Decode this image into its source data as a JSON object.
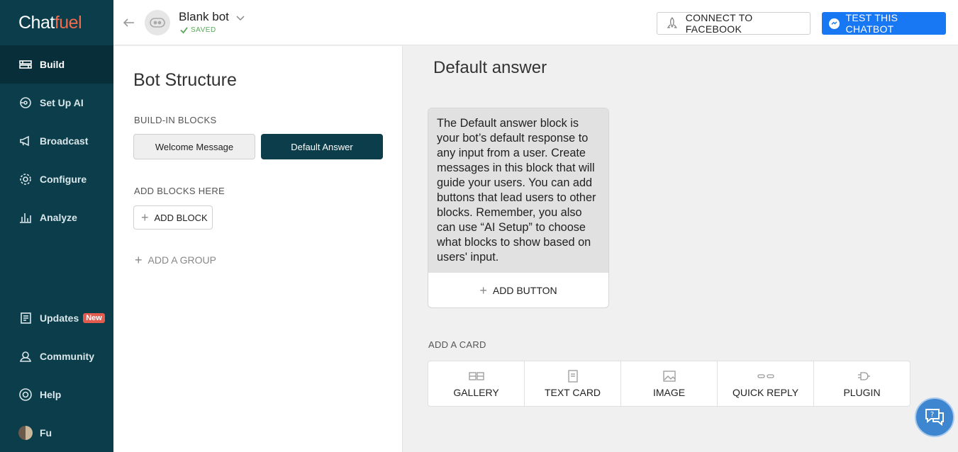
{
  "brand": {
    "logo_part1": "Chat",
    "logo_part2": "fuel"
  },
  "sidebar": {
    "items": [
      {
        "label": "Build",
        "icon": "build-icon"
      },
      {
        "label": "Set Up AI",
        "icon": "ai-icon"
      },
      {
        "label": "Broadcast",
        "icon": "megaphone-icon"
      },
      {
        "label": "Configure",
        "icon": "gear-icon"
      },
      {
        "label": "Analyze",
        "icon": "bar-chart-icon"
      },
      {
        "label": "Updates",
        "icon": "news-icon",
        "badge": "New"
      },
      {
        "label": "Community",
        "icon": "community-icon"
      },
      {
        "label": "Help",
        "icon": "lifebuoy-icon"
      },
      {
        "label": "Fu",
        "icon": "user-avatar"
      }
    ]
  },
  "header": {
    "bot_name": "Blank bot",
    "status": "SAVED",
    "connect_label": "CONNECT TO FACEBOOK",
    "test_label": "TEST THIS CHATBOT"
  },
  "left_panel": {
    "title": "Bot Structure",
    "builtin_label": "BUILD-IN BLOCKS",
    "blocks": [
      "Welcome Message",
      "Default Answer"
    ],
    "add_blocks_label": "ADD BLOCKS HERE",
    "add_block_button": "ADD BLOCK",
    "add_group": "ADD A GROUP"
  },
  "main": {
    "title": "Default answer",
    "card_text": "The Default answer block is your bot’s default response to any input from a user. Create messages in this block that will guide your users. You can add buttons that lead users to other blocks. Remember, you also can use “AI Setup” to choose what blocks to show based on users' input.",
    "add_button_label": "ADD BUTTON",
    "add_card_label": "ADD A CARD",
    "card_types": [
      "GALLERY",
      "TEXT CARD",
      "IMAGE",
      "QUICK REPLY",
      "PLUGIN"
    ]
  },
  "colors": {
    "sidebar_bg": "#0b3d4a",
    "accent_facebook": "#1877f2",
    "logo_accent": "#f36b4a",
    "badge": "#e35a4f"
  }
}
